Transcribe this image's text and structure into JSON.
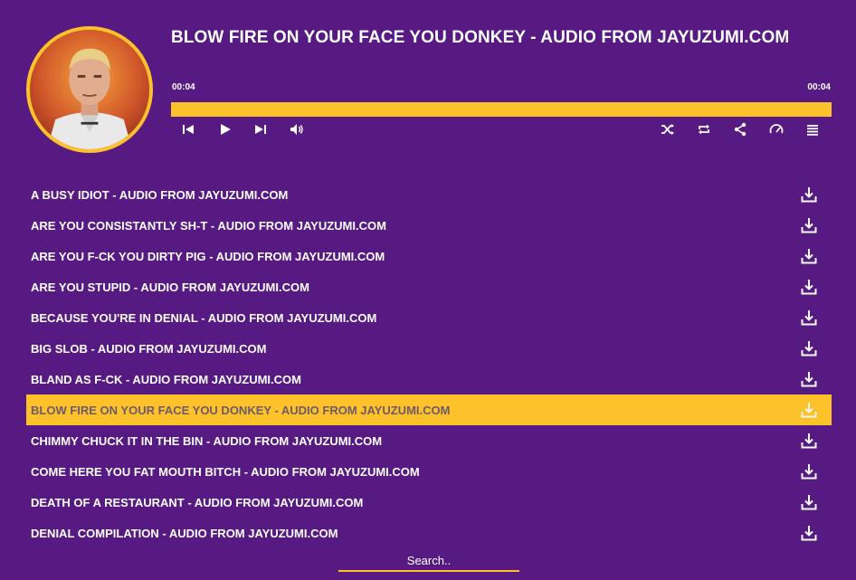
{
  "player": {
    "now_playing": "BLOW FIRE ON YOUR FACE YOU DONKEY - AUDIO FROM JAYUZUMI.COM",
    "current_time": "00:04",
    "duration": "00:04",
    "progress_percent": 100
  },
  "controls": {
    "left": [
      "previous-icon",
      "play-icon",
      "next-icon",
      "volume-icon"
    ],
    "right": [
      "shuffle-icon",
      "repeat-icon",
      "share-icon",
      "speed-icon",
      "playlist-icon"
    ]
  },
  "playlist": {
    "active_index": 7,
    "items": [
      {
        "label": "A BUSY IDIOT - AUDIO FROM JAYUZUMI.COM"
      },
      {
        "label": "ARE YOU CONSISTANTLY SH-T - AUDIO FROM JAYUZUMI.COM"
      },
      {
        "label": "ARE YOU F-CK YOU DIRTY PIG - AUDIO FROM JAYUZUMI.COM"
      },
      {
        "label": "ARE YOU STUPID - AUDIO FROM JAYUZUMI.COM"
      },
      {
        "label": "BECAUSE YOU'RE IN DENIAL - AUDIO FROM JAYUZUMI.COM"
      },
      {
        "label": "BIG SLOB - AUDIO FROM JAYUZUMI.COM"
      },
      {
        "label": "BLAND AS F-CK - AUDIO FROM JAYUZUMI.COM"
      },
      {
        "label": "BLOW FIRE ON YOUR FACE YOU DONKEY - AUDIO FROM JAYUZUMI.COM"
      },
      {
        "label": "CHIMMY CHUCK IT IN THE BIN - AUDIO FROM JAYUZUMI.COM"
      },
      {
        "label": "COME HERE YOU FAT MOUTH BITCH - AUDIO FROM JAYUZUMI.COM"
      },
      {
        "label": "DEATH OF A RESTAURANT - AUDIO FROM JAYUZUMI.COM"
      },
      {
        "label": "DENIAL COMPILATION - AUDIO FROM JAYUZUMI.COM"
      }
    ]
  },
  "search": {
    "placeholder": "Search.."
  },
  "colors": {
    "background": "#571a82",
    "accent": "#fdc12a",
    "text": "#ffffff"
  }
}
